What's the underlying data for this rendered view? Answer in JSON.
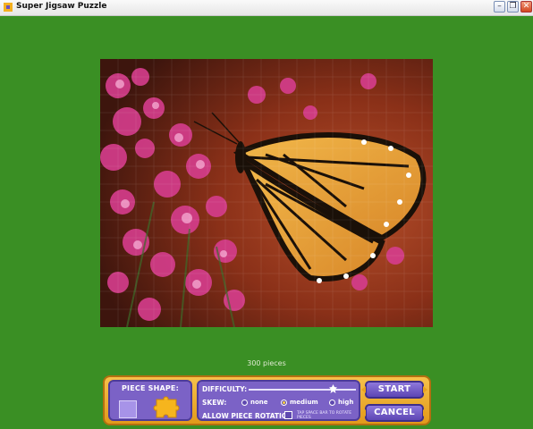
{
  "window": {
    "title": "Super Jigsaw Puzzle",
    "controls": [
      "minimize-icon",
      "restore-icon",
      "close-icon"
    ]
  },
  "puzzle": {
    "image_subject": "monarch-butterfly-on-pink-flowers",
    "pieces_label": "300 pieces"
  },
  "options": {
    "piece_shape_label": "PIECE SHAPE:",
    "shapes": [
      "square",
      "jigsaw"
    ],
    "difficulty_label": "DIFFICULTY:",
    "difficulty_level": 0.78,
    "skew_label": "SKEW:",
    "skew_options": [
      "none",
      "medium",
      "high"
    ],
    "skew_selected": "medium",
    "rotation_label": "ALLOW PIECE ROTATION",
    "rotation_checked": false,
    "rotation_hint": "TAP SPACE BAR TO ROTATE PIECES"
  },
  "buttons": {
    "start": "START",
    "cancel": "CANCEL"
  },
  "colors": {
    "background": "#3a8f24",
    "panel": "#e9a826",
    "panel_box": "#7b62c6"
  }
}
